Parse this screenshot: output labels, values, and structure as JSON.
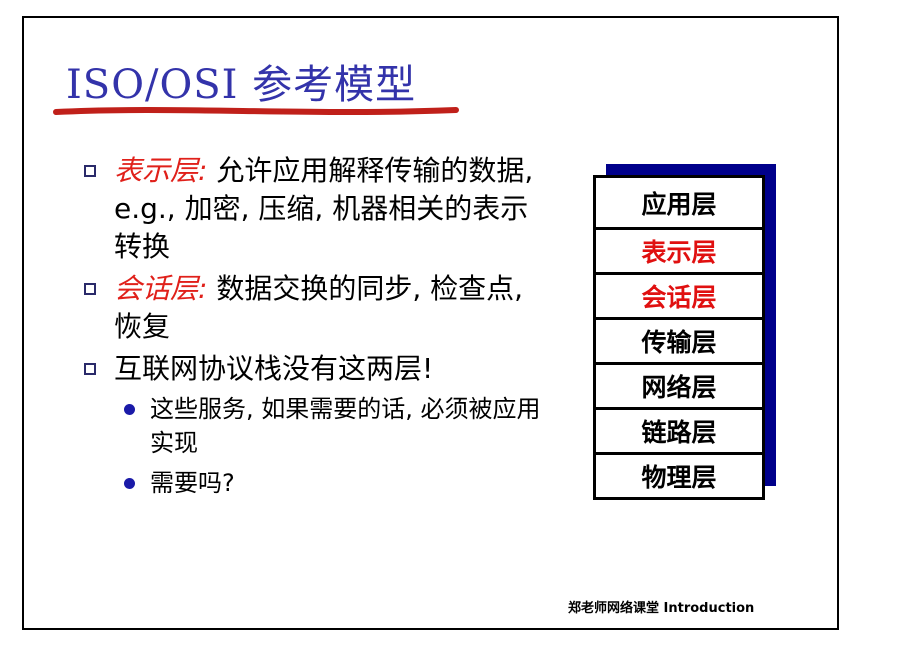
{
  "slide": {
    "title": "ISO/OSI 参考模型",
    "bullets": [
      {
        "term": "表示层:",
        "text": " 允许应用解释传输的数据, e.g., 加密, 压缩, 机器相关的表示转换"
      },
      {
        "term": "会话层:",
        "text": " 数据交换的同步, 检查点, 恢复"
      },
      {
        "term": "",
        "text": "互联网协议栈没有这两层!"
      }
    ],
    "sub_bullets": [
      "这些服务, 如果需要的话, 必须被应用实现",
      "需要吗?"
    ],
    "layers": [
      "应用层",
      "表示层",
      "会话层",
      "传输层",
      "网络层",
      "链路层",
      "物理层"
    ],
    "highlight_color": "#e01010",
    "footer": "郑老师网络课堂 Introduction"
  }
}
